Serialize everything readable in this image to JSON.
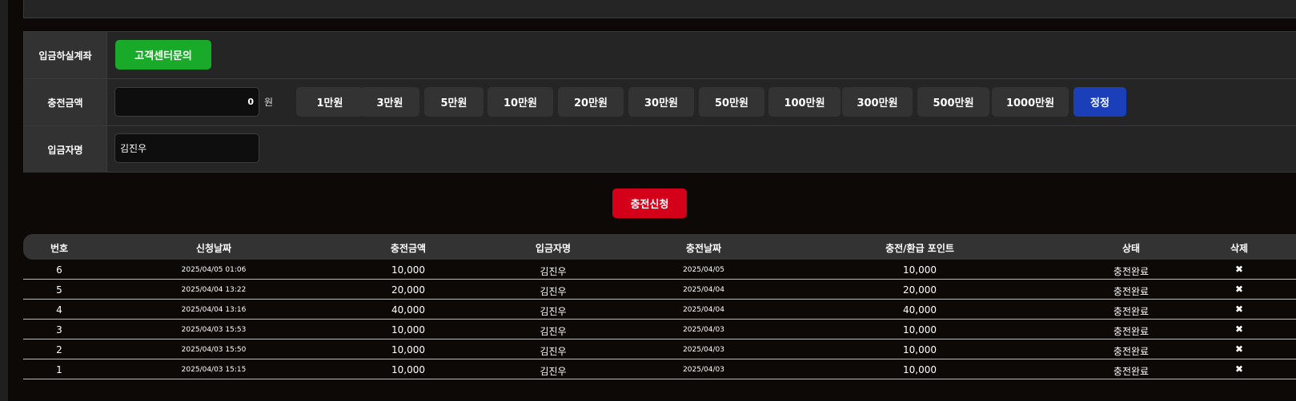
{
  "form": {
    "deposit_account_label": "입금하실계좌",
    "support_button": "고객센터문의",
    "charge_amount_label": "충전금액",
    "amount_value": "0",
    "amount_unit": "원",
    "amount_buttons": [
      "1만원",
      "3만원",
      "5만원",
      "10만원",
      "20만원",
      "30만원",
      "50만원",
      "100만원",
      "300만원",
      "500만원",
      "1000만원"
    ],
    "reset_button": "정정",
    "depositor_label": "입금자명",
    "depositor_value": "김진우"
  },
  "submit_button": "충전신청",
  "table": {
    "headers": [
      "번호",
      "신청날짜",
      "충전금액",
      "입금자명",
      "충전날짜",
      "충전/환급 포인트",
      "상태",
      "삭제"
    ],
    "delete_icon": "✖",
    "rows": [
      {
        "no": "6",
        "request_date": "2025/04/05 01:06",
        "amount": "10,000",
        "name": "김진우",
        "charge_date": "2025/04/05",
        "points": "10,000",
        "status": "충전완료"
      },
      {
        "no": "5",
        "request_date": "2025/04/04 13:22",
        "amount": "20,000",
        "name": "김진우",
        "charge_date": "2025/04/04",
        "points": "20,000",
        "status": "충전완료"
      },
      {
        "no": "4",
        "request_date": "2025/04/04 13:16",
        "amount": "40,000",
        "name": "김진우",
        "charge_date": "2025/04/04",
        "points": "40,000",
        "status": "충전완료"
      },
      {
        "no": "3",
        "request_date": "2025/04/03 15:53",
        "amount": "10,000",
        "name": "김진우",
        "charge_date": "2025/04/03",
        "points": "10,000",
        "status": "충전완료"
      },
      {
        "no": "2",
        "request_date": "2025/04/03 15:50",
        "amount": "10,000",
        "name": "김진우",
        "charge_date": "2025/04/03",
        "points": "10,000",
        "status": "충전완료"
      },
      {
        "no": "1",
        "request_date": "2025/04/03 15:15",
        "amount": "10,000",
        "name": "김진우",
        "charge_date": "2025/04/03",
        "points": "10,000",
        "status": "충전완료"
      }
    ]
  },
  "colors": {
    "support_green": "#1aaa2a",
    "reset_blue": "#1a3fb8",
    "submit_red": "#d4001a",
    "panel_bg": "#252525",
    "page_bg": "#0d0907"
  }
}
